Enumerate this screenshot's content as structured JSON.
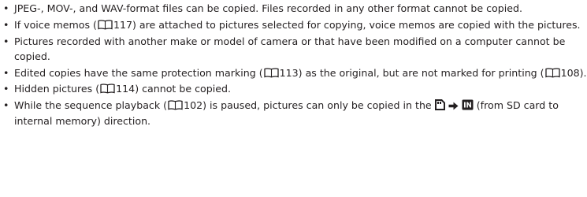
{
  "notes": [
    {
      "bullet": "•",
      "text": "JPEG-, MOV-, and WAV-format files can be copied. Files recorded in any other format cannot be copied."
    },
    {
      "bullet": "•",
      "pre": "If voice memos (",
      "ref_icon": "book-reference-icon",
      "page": "117",
      "post": ") are attached to pictures selected for copying, voice memos are copied with the pictures."
    },
    {
      "bullet": "•",
      "text": "Pictures recorded with another make or model of camera or that have been modified on a computer cannot be copied."
    },
    {
      "bullet": "•",
      "pre": "Edited copies have the same protection marking (",
      "page": "113",
      "mid": ") as the original, but are not marked for printing (",
      "page2": "108",
      "post": ")."
    },
    {
      "bullet": "•",
      "pre": "Hidden pictures (",
      "page": "114",
      "post": ") cannot be copied."
    },
    {
      "bullet": "•",
      "pre": "While the sequence playback (",
      "page": "102",
      "mid": ") is paused, pictures can only be copied in the",
      "icons": [
        "sd-card-icon",
        "right-arrow-icon",
        "internal-memory-icon"
      ],
      "post": "(from SD card to internal memory) direction."
    }
  ]
}
